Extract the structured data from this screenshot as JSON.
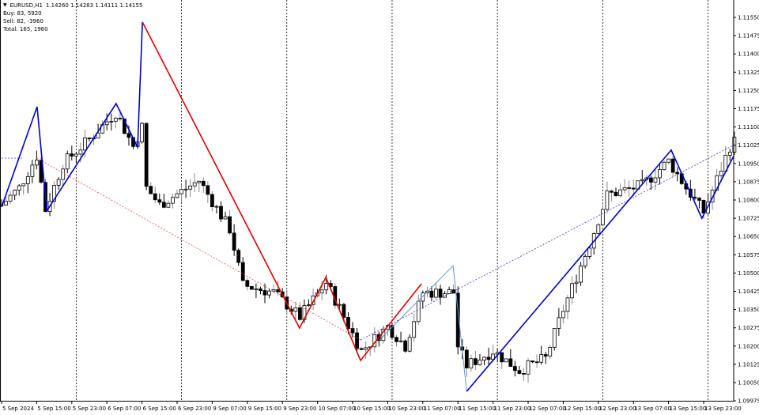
{
  "header": {
    "symbol": "EURUSD,H1",
    "ohlc": "1.14260 1.14283 1.14111 1.14155",
    "buy": "Buy: 83, 5920",
    "sell": "Sell: 82, -3960",
    "total": "Total: 165, 1960"
  },
  "chart_data": {
    "type": "candlestick",
    "symbol": "EURUSD",
    "timeframe": "H1",
    "ylim": [
      1.09975,
      1.1159
    ],
    "price_labels": [
      "1.11550",
      "1.11475",
      "1.11400",
      "1.11325",
      "1.11250",
      "1.11175",
      "1.11100",
      "1.11025",
      "1.10950",
      "1.10875",
      "1.10800",
      "1.10725",
      "1.10650",
      "1.10575",
      "1.10500",
      "1.10425",
      "1.10350",
      "1.10275",
      "1.10200",
      "1.10125",
      "1.10050",
      "1.09975"
    ],
    "time_labels": [
      "5 Sep 2024",
      "5 Sep 15:00",
      "5 Sep 23:00",
      "6 Sep 07:00",
      "6 Sep 15:00",
      "6 Sep 23:00",
      "9 Sep 07:00",
      "9 Sep 15:00",
      "9 Sep 23:00",
      "10 Sep 07:00",
      "10 Sep 15:00",
      "10 Sep 23:00",
      "11 Sep 07:00",
      "11 Sep 15:00",
      "11 Sep 23:00",
      "12 Sep 07:00",
      "12 Sep 15:00",
      "12 Sep 23:00",
      "13 Sep 07:00",
      "13 Sep 15:00",
      "13 Sep 23:00"
    ],
    "bar_count": 168,
    "day_separator_bars": [
      17,
      41,
      65,
      89,
      113,
      137,
      161
    ],
    "close_path": [
      [
        0,
        1.1078
      ],
      [
        4,
        1.1085
      ],
      [
        8,
        1.1098
      ],
      [
        10,
        1.1076
      ],
      [
        14,
        1.1095
      ],
      [
        20,
        1.1105
      ],
      [
        26,
        1.1116
      ],
      [
        30,
        1.1102
      ],
      [
        32,
        1.111
      ],
      [
        33,
        1.1085
      ],
      [
        36,
        1.1078
      ],
      [
        45,
        1.1088
      ],
      [
        52,
        1.1068
      ],
      [
        55,
        1.1045
      ],
      [
        62,
        1.1042
      ],
      [
        68,
        1.1032
      ],
      [
        74,
        1.1046
      ],
      [
        82,
        1.1018
      ],
      [
        88,
        1.1028
      ],
      [
        92,
        1.102
      ],
      [
        96,
        1.1042
      ],
      [
        103,
        1.1042
      ],
      [
        104,
        1.102
      ],
      [
        106,
        1.1012
      ],
      [
        112,
        1.1018
      ],
      [
        118,
        1.101
      ],
      [
        124,
        1.1015
      ],
      [
        128,
        1.1035
      ],
      [
        134,
        1.1062
      ],
      [
        138,
        1.1082
      ],
      [
        146,
        1.1086
      ],
      [
        152,
        1.1096
      ],
      [
        156,
        1.1085
      ],
      [
        160,
        1.1075
      ],
      [
        166,
        1.1102
      ],
      [
        167,
        1.1104
      ]
    ],
    "zigzag_blue_1": [
      [
        0,
        1.10771
      ],
      [
        8.1,
        1.11183
      ],
      [
        10.3,
        1.10755
      ],
      [
        26.1,
        1.11196
      ],
      [
        31,
        1.11017
      ],
      [
        32.1,
        1.11531
      ]
    ],
    "zigzag_red": [
      [
        32.1,
        1.11531
      ],
      [
        67.9,
        1.10274
      ],
      [
        73.9,
        1.10482
      ],
      [
        81.8,
        1.10141
      ],
      [
        95.7,
        1.10456
      ]
    ],
    "zigzag_lightblue": [
      [
        86.1,
        1.10225
      ],
      [
        102.9,
        1.1053
      ],
      [
        106,
        1.10014
      ]
    ],
    "zigzag_blue_2": [
      [
        106,
        1.10014
      ],
      [
        152.6,
        1.11005
      ],
      [
        159.6,
        1.10725
      ],
      [
        166.8,
        1.10979
      ]
    ],
    "trend_dotted_blue_1": [
      [
        0,
        1.10972
      ],
      [
        5,
        1.10972
      ]
    ],
    "trend_dotted_red": [
      [
        8,
        1.10972
      ],
      [
        81.8,
        1.10225
      ]
    ],
    "trend_dotted_blue_2": [
      [
        81.8,
        1.10225
      ],
      [
        167,
        1.11027
      ]
    ],
    "colors": {
      "blue": "#0000cc",
      "red": "#e00000",
      "lightblue": "#5b9bd5",
      "dotted_red": "#e05050",
      "dotted_blue": "#3333cc"
    }
  }
}
